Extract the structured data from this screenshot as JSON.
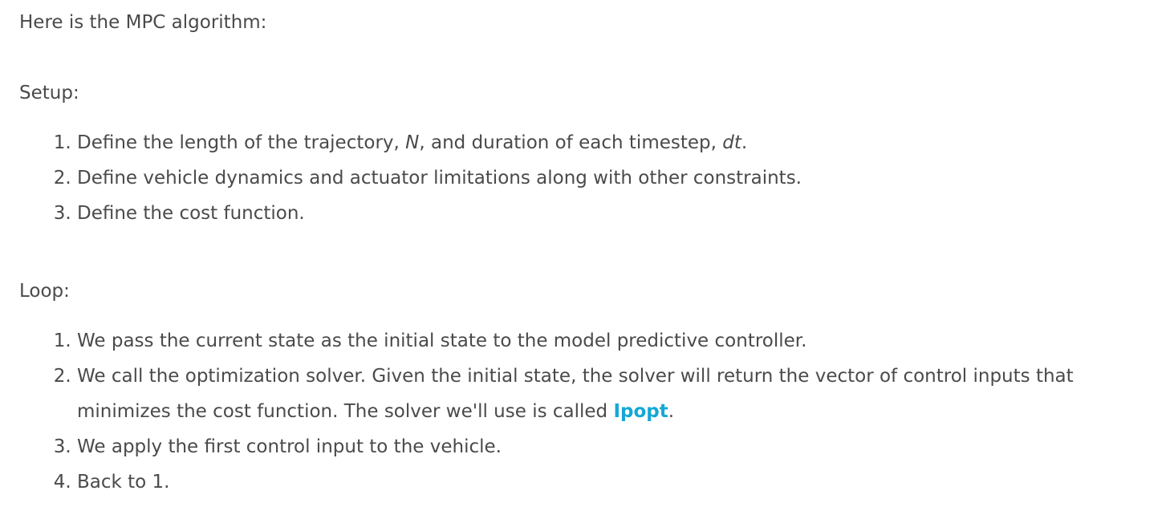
{
  "intro": "Here is the MPC algorithm:",
  "setup": {
    "label": "Setup:",
    "items": [
      {
        "pre": "Define the length of the trajectory, ",
        "var1": "N",
        "mid": ", and duration of each timestep, ",
        "var2": "dt",
        "post": "."
      },
      {
        "text": "Define vehicle dynamics and actuator limitations along with other constraints."
      },
      {
        "text": "Define the cost function."
      }
    ]
  },
  "loop": {
    "label": "Loop:",
    "items": [
      {
        "text": "We pass the current state as the initial state to the model predictive controller."
      },
      {
        "pre": "We call the optimization solver. Given the initial state, the solver will return the vector of control inputs that minimizes the cost function. The solver we'll use is called ",
        "link": "Ipopt",
        "post": "."
      },
      {
        "text": "We apply the first control input to the vehicle."
      },
      {
        "text": "Back to 1."
      }
    ]
  },
  "colors": {
    "text": "#4a4a4a",
    "link": "#14a7d6"
  }
}
